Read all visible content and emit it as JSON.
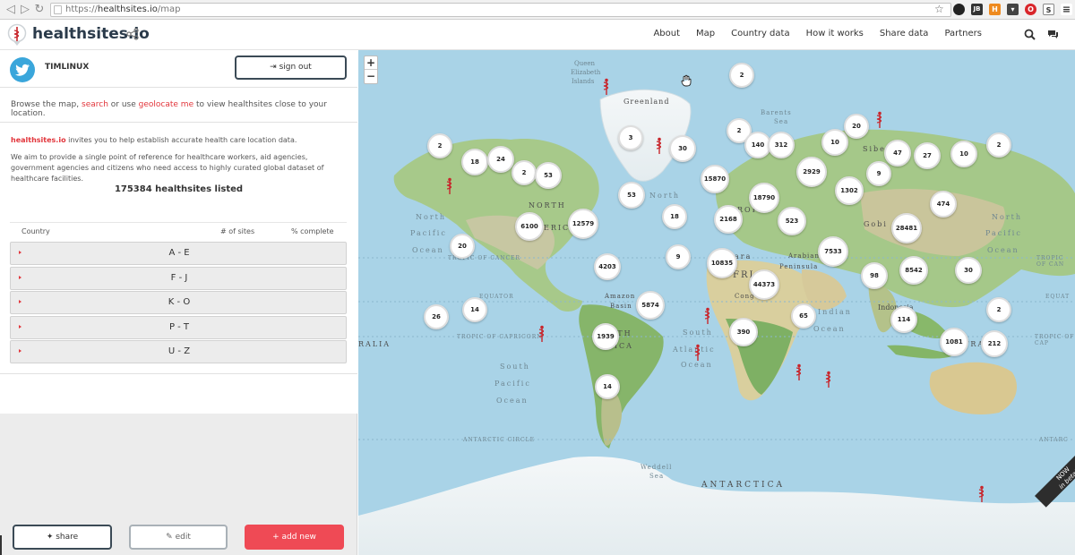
{
  "browser": {
    "url_scheme": "https://",
    "url_host": "healthsites.io",
    "url_path": "/map"
  },
  "brand": {
    "name": "healthsites.io"
  },
  "nav": {
    "links": [
      "About",
      "Map",
      "Country data",
      "How it works",
      "Share data",
      "Partners"
    ]
  },
  "user": {
    "name": "TIMLINUX",
    "signout_label": "sign out"
  },
  "intro": {
    "browse_prefix": "Browse the map,",
    "search_link": "search",
    "browse_mid": "or use",
    "geolocate_link": "geolocate me",
    "browse_suffix": "to view healthsites close to your location.",
    "invite_brand": "healthsites.io",
    "invite_text": "invites you to help establish accurate health care location data.",
    "aim_text": "We aim to provide a single point of reference for healthcare workers, aid agencies, government agencies and citizens who need access to highly curated global dataset of healthcare facilities.",
    "listed": "175384 healthsites listed"
  },
  "table": {
    "headers": [
      "Country",
      "# of sites",
      "% complete"
    ],
    "rows": [
      "A - E",
      "F - J",
      "K - O",
      "P - T",
      "U - Z"
    ]
  },
  "footer": {
    "share": "share",
    "edit": "edit",
    "add": "add new"
  },
  "map": {
    "zoom_in": "+",
    "zoom_out": "−",
    "clusters": [
      "2",
      "2",
      "18",
      "24",
      "2",
      "53",
      "53",
      "6100",
      "12579",
      "20",
      "4203",
      "14",
      "26",
      "1939",
      "14",
      "5874",
      "9",
      "18",
      "3",
      "30",
      "2",
      "140",
      "312",
      "10",
      "20",
      "15870",
      "18790",
      "2168",
      "2929",
      "1302",
      "9",
      "47",
      "27",
      "10",
      "2",
      "523",
      "474",
      "28481",
      "10835",
      "44373",
      "7533",
      "98",
      "8542",
      "30",
      "390",
      "65",
      "114",
      "2",
      "1081",
      "212"
    ],
    "labels": {
      "greenland": "Greenland",
      "queen_elizabeth_1": "Queen",
      "queen_elizabeth_2": "Elizabeth",
      "queen_elizabeth_3": "Islands",
      "barents_1": "Barents",
      "barents_2": "Sea",
      "siberia": "Siber",
      "north_atl": "North",
      "north_pac_l1": "North",
      "north_pac_l2": "Pacific",
      "north_pac_l3": "Ocean",
      "north_pac_r1": "North",
      "north_pac_r2": "Pacific",
      "north_pac_r3": "Ocean",
      "north_am": "NORTH",
      "america": "ERICA",
      "europe": "ROP",
      "asia": "A",
      "gobi": "Gobi",
      "sahara": "ara",
      "africa": "FRI",
      "arabian": "Arabian",
      "peninsula": "Peninsula",
      "congo": "Cong",
      "amazon": "Amazon",
      "basin": "Basin",
      "south_am": "OUTH",
      "south_am2": "ERICA",
      "indian_1": "Indian",
      "indian_2": "Ocean",
      "indonesia": "Indonesia",
      "australia": "AUSTRA",
      "south_atl_1": "South",
      "south_atl_2": "Atlantic",
      "south_atl_3": "Ocean",
      "south_pac_1": "South",
      "south_pac_2": "Pacific",
      "south_pac_3": "Ocean",
      "weddell_1": "Weddell",
      "weddell_2": "Sea",
      "antarctica": "ANTARCTICA",
      "tropic_cancer_l": "TROPIC OF CANCER",
      "tropic_cancer_r": "TROPIC OF CAN",
      "equator_l": "EQUATOR",
      "equator_r": "EQUAT",
      "tropic_capricorn": "TROPIC OF CAPRICORN",
      "tropic_capricorn_r": "TROPIC OF CAP",
      "antarctic_circle": "ANTARCTIC CIRCLE",
      "antarctic_circle_r": "ANTARC",
      "ralia": "RALIA"
    },
    "beta_1": "NOW",
    "beta_2": "in beta!"
  }
}
